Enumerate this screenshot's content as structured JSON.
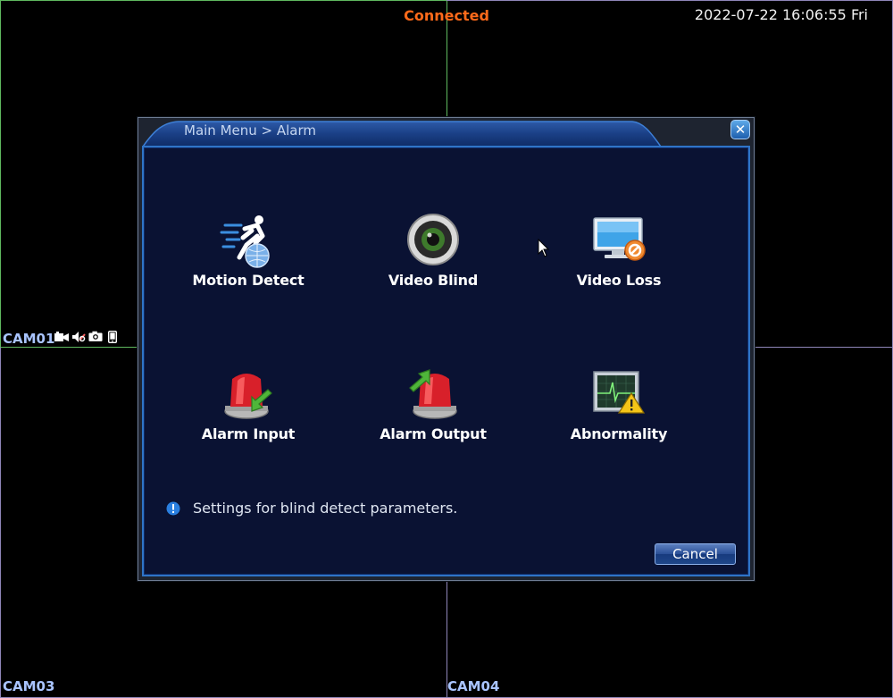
{
  "overlay": {
    "connection_status": "Connected",
    "datetime": "2022-07-22 16:06:55 Fri",
    "cameras": [
      "CAM01",
      "CAM03",
      "CAM04"
    ],
    "cam01_status_icons": [
      "video-camera-icon",
      "audio-muted-icon",
      "snapshot-icon",
      "phone-icon"
    ]
  },
  "dialog": {
    "breadcrumb": "Main Menu > Alarm",
    "close_icon": "close-icon",
    "menu_items": [
      {
        "label": "Motion Detect",
        "icon": "motion-detect-icon"
      },
      {
        "label": "Video Blind",
        "icon": "video-blind-icon"
      },
      {
        "label": "Video Loss",
        "icon": "video-loss-icon"
      },
      {
        "label": "Alarm Input",
        "icon": "alarm-input-icon"
      },
      {
        "label": "Alarm Output",
        "icon": "alarm-output-icon"
      },
      {
        "label": "Abnormality",
        "icon": "abnormality-icon"
      }
    ],
    "hint": "Settings for blind detect parameters.",
    "cancel_label": "Cancel"
  },
  "colors": {
    "connected": "#ff6a1a",
    "panel_bg": "#0a1233",
    "panel_border": "#2f74c7",
    "camera_label": "#a9c4ff"
  }
}
